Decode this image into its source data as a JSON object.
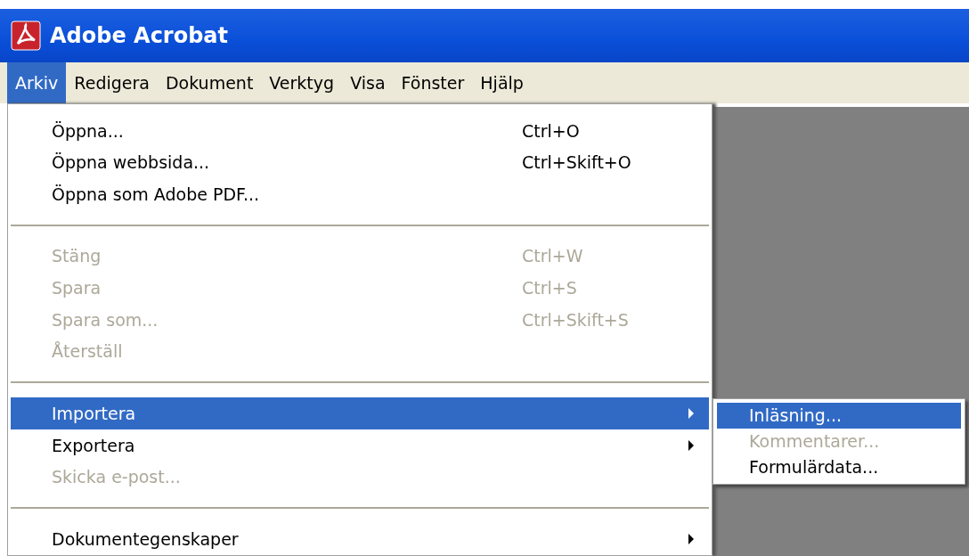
{
  "window": {
    "title": "Adobe Acrobat"
  },
  "menu_bar": [
    {
      "label": "Arkiv",
      "selected": true
    },
    {
      "label": "Redigera",
      "selected": false
    },
    {
      "label": "Dokument",
      "selected": false
    },
    {
      "label": "Verktyg",
      "selected": false
    },
    {
      "label": "Visa",
      "selected": false
    },
    {
      "label": "Fönster",
      "selected": false
    },
    {
      "label": "Hjälp",
      "selected": false
    }
  ],
  "file_menu": [
    {
      "kind": "item",
      "label": "Öppna...",
      "shortcut": "Ctrl+O",
      "disabled": false,
      "selected": false,
      "submenu": false
    },
    {
      "kind": "item",
      "label": "Öppna webbsida...",
      "shortcut": "Ctrl+Skift+O",
      "disabled": false,
      "selected": false,
      "submenu": false
    },
    {
      "kind": "item",
      "label": "Öppna som Adobe PDF...",
      "disabled": false,
      "selected": false,
      "submenu": false
    },
    {
      "kind": "separator"
    },
    {
      "kind": "item",
      "label": "Stäng",
      "shortcut": "Ctrl+W",
      "disabled": true,
      "selected": false,
      "submenu": false
    },
    {
      "kind": "item",
      "label": "Spara",
      "shortcut": "Ctrl+S",
      "disabled": true,
      "selected": false,
      "submenu": false
    },
    {
      "kind": "item",
      "label": "Spara som...",
      "shortcut": "Ctrl+Skift+S",
      "disabled": true,
      "selected": false,
      "submenu": false
    },
    {
      "kind": "item",
      "label": "Återställ",
      "disabled": true,
      "selected": false,
      "submenu": false
    },
    {
      "kind": "separator"
    },
    {
      "kind": "item",
      "label": "Importera",
      "disabled": false,
      "selected": true,
      "submenu": true
    },
    {
      "kind": "item",
      "label": "Exportera",
      "disabled": false,
      "selected": false,
      "submenu": true
    },
    {
      "kind": "item",
      "label": "Skicka e-post...",
      "disabled": true,
      "selected": false,
      "submenu": false
    },
    {
      "kind": "separator"
    },
    {
      "kind": "item",
      "label": "Dokumentegenskaper",
      "disabled": false,
      "selected": false,
      "submenu": true
    }
  ],
  "submenu": [
    {
      "label": "Inläsning...",
      "disabled": false,
      "selected": true
    },
    {
      "label": "Kommentarer...",
      "disabled": true,
      "selected": false
    },
    {
      "label": "Formulärdata...",
      "disabled": false,
      "selected": false
    }
  ]
}
